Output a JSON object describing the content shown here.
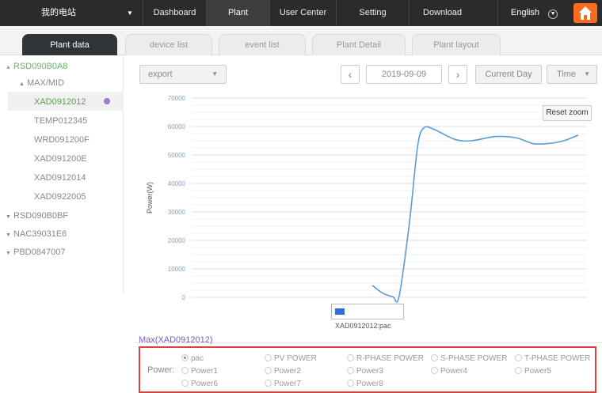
{
  "topbar": {
    "site": "我的电站",
    "menu": [
      "Dashboard",
      "Plant",
      "User Center",
      "Setting",
      "Download"
    ],
    "active": "Plant",
    "language": "English"
  },
  "tabs": [
    "Plant data",
    "device list",
    "event list",
    "Plant Detail",
    "Plant layout"
  ],
  "tree": {
    "root": "RSD090B0A8",
    "group": "MAX/MID",
    "devices": [
      "XAD0912012",
      "TEMP012345",
      "WRD091200F",
      "XAD091200E",
      "XAD0912014",
      "XAD0922005"
    ],
    "others": [
      "RSD090B0BF",
      "NAC39031E6",
      "PBD0847007"
    ]
  },
  "controls": {
    "export": "export",
    "date": "2019-09-09",
    "current_day": "Current Day",
    "time": "Time"
  },
  "chart_data": {
    "type": "line",
    "ylabel": "Power(W)",
    "yticks": [
      0,
      10000,
      20000,
      30000,
      40000,
      50000,
      60000,
      70000
    ],
    "ylim": [
      0,
      70000
    ],
    "series": [
      {
        "name": "XAD0912012:pac",
        "color": "#5b9bd5",
        "points": [
          [
            0.0,
            4200
          ],
          [
            0.05,
            1500
          ],
          [
            0.1,
            200
          ],
          [
            0.13,
            300
          ],
          [
            0.18,
            26000
          ],
          [
            0.22,
            53000
          ],
          [
            0.25,
            59500
          ],
          [
            0.3,
            59000
          ],
          [
            0.4,
            55500
          ],
          [
            0.48,
            55000
          ],
          [
            0.6,
            56500
          ],
          [
            0.7,
            56000
          ],
          [
            0.78,
            54000
          ],
          [
            0.85,
            54000
          ],
          [
            0.93,
            55000
          ],
          [
            1.0,
            57000
          ]
        ]
      }
    ],
    "reset_zoom": "Reset zoom"
  },
  "max_label": "Max(XAD0912012)",
  "power": {
    "label": "Power:",
    "row1": [
      "pac",
      "PV POWER",
      "R-PHASE POWER",
      "S-PHASE POWER",
      "T-PHASE POWER"
    ],
    "row2": [
      "Power1",
      "Power2",
      "Power3",
      "Power4",
      "Power5"
    ],
    "row3": [
      "Power6",
      "Power7",
      "Power8"
    ],
    "selected": "pac"
  }
}
